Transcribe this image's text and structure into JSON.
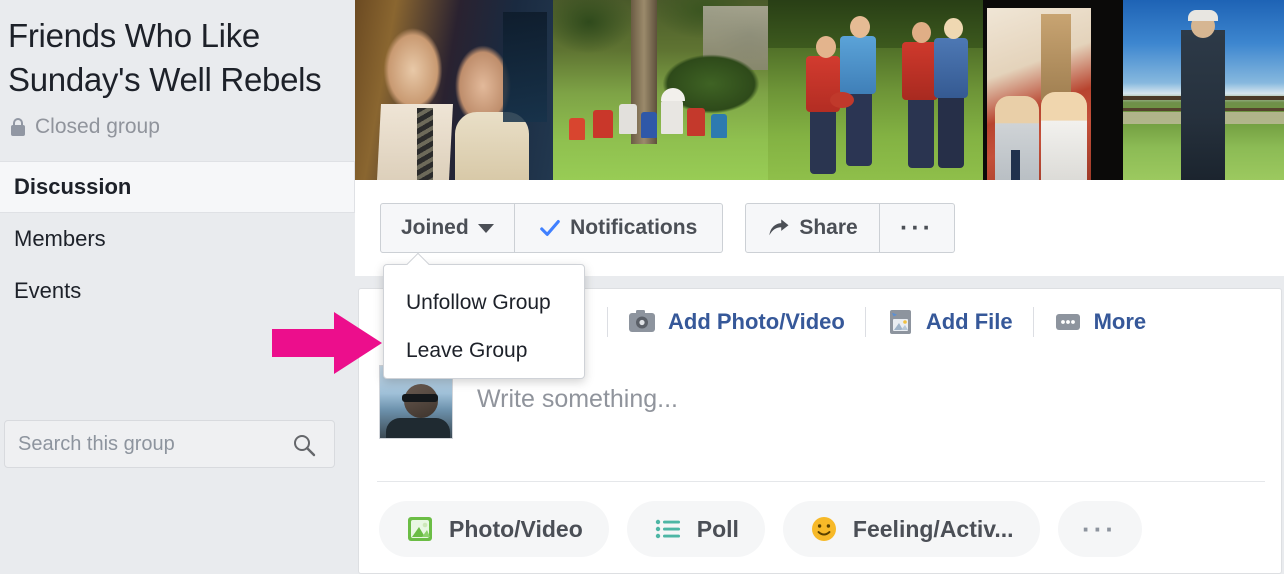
{
  "group": {
    "title": "Friends Who Like Sunday's Well Rebels",
    "privacy_label": "Closed group",
    "privacy_icon": "lock-icon"
  },
  "sidebar": {
    "nav_items": [
      {
        "label": "Discussion",
        "active": true
      },
      {
        "label": "Members",
        "active": false
      },
      {
        "label": "Events",
        "active": false
      }
    ],
    "search": {
      "placeholder": "Search this group",
      "value": "",
      "icon": "search-icon"
    }
  },
  "cover": {
    "photos": [
      {
        "alt": "Couple at a formal event"
      },
      {
        "alt": "Garden with tree and gnomes"
      },
      {
        "alt": "Rugby players on pitch"
      },
      {
        "alt": "Two boys indoors"
      },
      {
        "alt": "Man standing outdoors by fence"
      }
    ]
  },
  "action_bar": {
    "joined_label": "Joined",
    "joined_caret": "chevron-down-icon",
    "notifications_label": "Notifications",
    "notifications_icon": "check-icon",
    "share_label": "Share",
    "share_icon": "share-arrow-icon",
    "more_label": "···"
  },
  "dropdown": {
    "open": true,
    "items": [
      {
        "label": "Unfollow Group"
      },
      {
        "label": "Leave Group"
      }
    ]
  },
  "composer": {
    "tabs": [
      {
        "label": "Add Photo/Video",
        "icon": "camera-icon"
      },
      {
        "label": "Add File",
        "icon": "file-image-icon"
      },
      {
        "label": "More",
        "icon": "more-dots-icon"
      }
    ],
    "avatar_alt": "User profile photo",
    "placeholder": "Write something...",
    "pills": [
      {
        "label": "Photo/Video",
        "icon": "photo-icon"
      },
      {
        "label": "Poll",
        "icon": "poll-list-icon"
      },
      {
        "label": "Feeling/Activ...",
        "icon": "smiley-icon"
      },
      {
        "label": "···",
        "icon": "more-dots-icon"
      }
    ]
  },
  "annotation": {
    "arrow_color": "#EC0E8C",
    "points_to": "Leave Group"
  },
  "colors": {
    "facebook_blue": "#365899",
    "check_blue": "#4080ff",
    "page_bg": "#e9ebee",
    "card_bg": "#ffffff",
    "text_dark": "#1d2129",
    "text_muted": "#90949c",
    "pink_arrow": "#EC0E8C",
    "green_photo": "#6bbd45",
    "teal_poll": "#4db6a5",
    "yellow_smiley": "#f7b928"
  }
}
